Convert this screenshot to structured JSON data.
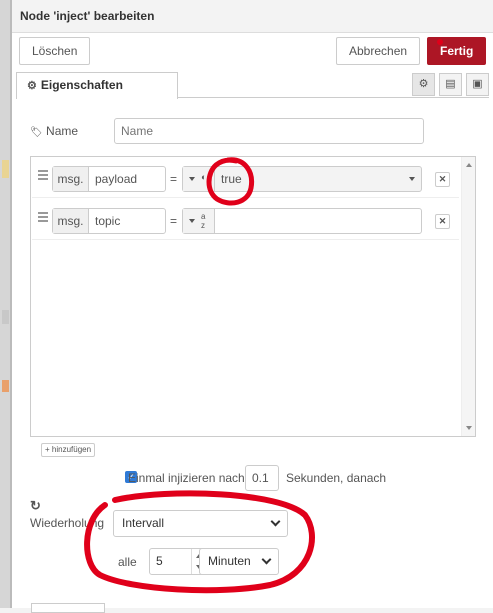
{
  "header": {
    "title": "Node 'inject' bearbeiten",
    "delete_label": "Löschen",
    "cancel_label": "Abbrechen",
    "done_label": "Fertig"
  },
  "tabs": {
    "properties_label": "Eigenschaften",
    "icon_tabs": [
      "gear-icon",
      "description-icon",
      "appearance-icon"
    ]
  },
  "name_field": {
    "label": "Name",
    "value": "",
    "placeholder": "Name"
  },
  "properties": [
    {
      "prefix": "msg.",
      "property": "payload",
      "equals": "=",
      "type_icon": "boolean-icon",
      "value": "true"
    },
    {
      "prefix": "msg.",
      "property": "topic",
      "equals": "=",
      "type_icon": "string-az-icon",
      "value": ""
    }
  ],
  "add_button_label": "+ hinzufügen",
  "inject_once": {
    "checked": true,
    "label": "Einmal injizieren nach",
    "delay": "0.1",
    "suffix": "Sekunden, danach"
  },
  "repeat": {
    "label": "Wiederholung",
    "mode": "Intervall",
    "every_label": "alle",
    "interval_value": "5",
    "unit": "Minuten"
  },
  "colors": {
    "primary": "#ad1625",
    "annotation": "#e0001a"
  }
}
